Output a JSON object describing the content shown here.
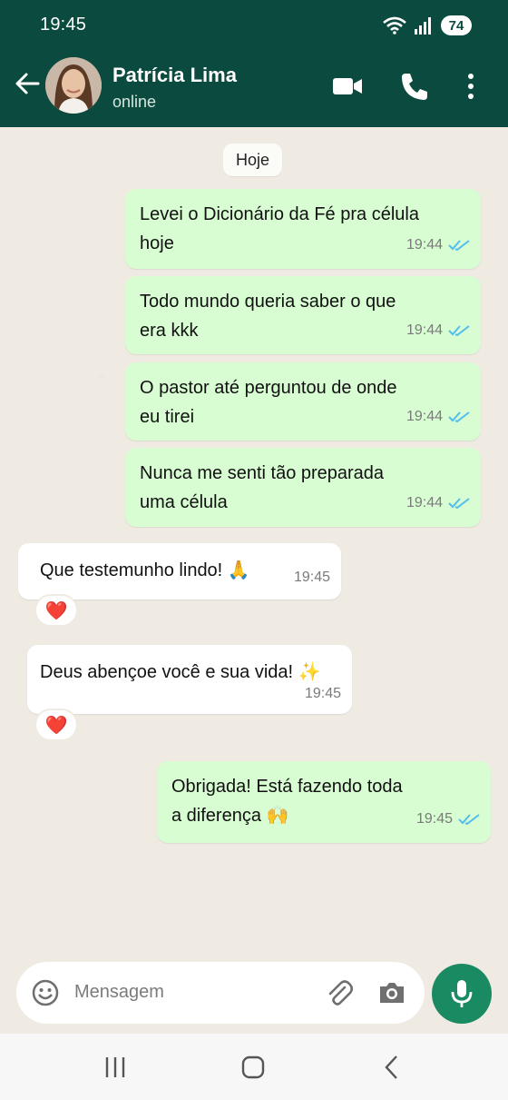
{
  "status_bar": {
    "time": "19:45",
    "battery": "74"
  },
  "header": {
    "contact_name": "Patrícia Lima",
    "contact_status": "online"
  },
  "chat": {
    "date_chip": "Hoje",
    "messages": [
      {
        "direction": "out",
        "text": "Levei o Dicionário da Fé pra célula\nhoje",
        "time": "19:44"
      },
      {
        "direction": "out",
        "text": "Todo mundo queria saber o que\nera kkk",
        "time": "19:44"
      },
      {
        "direction": "out",
        "text": "O pastor até perguntou de onde\neu tirei",
        "time": "19:44"
      },
      {
        "direction": "out",
        "text": "Nunca me senti tão preparada\numa célula",
        "time": "19:44"
      },
      {
        "direction": "in",
        "text": "Que testemunho lindo! 🙏",
        "time": "19:45",
        "reaction": "❤️"
      },
      {
        "direction": "in",
        "text": "Deus abençoe você e sua vida! ✨",
        "time": "19:45",
        "reaction": "❤️"
      },
      {
        "direction": "out",
        "text": "Obrigada! Está fazendo toda\na diferença 🙌",
        "time": "19:45"
      }
    ]
  },
  "composer": {
    "placeholder": "Mensagem"
  },
  "icons": {
    "back": "arrow-left-icon",
    "video": "video-camera-icon",
    "call": "phone-icon",
    "menu": "more-vertical-icon",
    "emoji": "emoji-icon",
    "attach": "paperclip-icon",
    "camera": "camera-icon",
    "mic": "microphone-icon"
  },
  "colors": {
    "header": "#0b4a3f",
    "outgoing_bubble": "#d9fdd3",
    "incoming_bubble": "#ffffff",
    "read_ticks": "#53bdeb",
    "mic_button": "#1a8a63"
  }
}
